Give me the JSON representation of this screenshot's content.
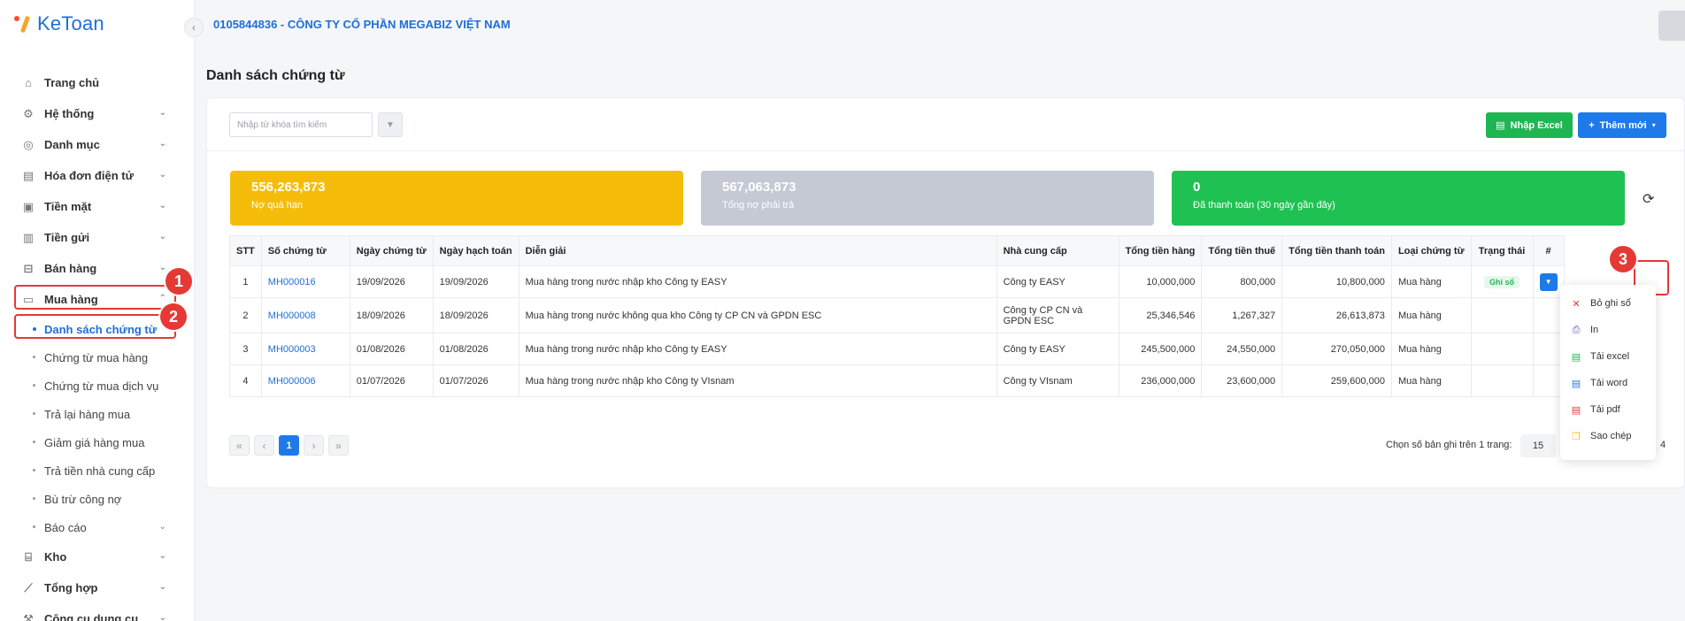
{
  "app": {
    "logo_text": "KeToan"
  },
  "header": {
    "company": "0105844836 - CÔNG TY CỔ PHẦN MEGABIZ VIỆT NAM"
  },
  "sidebar": {
    "items": [
      {
        "label": "Trang chủ",
        "icon": "home-icon"
      },
      {
        "label": "Hệ thống",
        "icon": "gear-icon"
      },
      {
        "label": "Danh mục",
        "icon": "grid-icon"
      },
      {
        "label": "Hóa đơn điện tử",
        "icon": "invoice-icon"
      },
      {
        "label": "Tiền mặt",
        "icon": "cash-icon"
      },
      {
        "label": "Tiền gửi",
        "icon": "bank-icon"
      },
      {
        "label": "Bán hàng",
        "icon": "sale-icon"
      },
      {
        "label": "Mua hàng",
        "icon": "folder-icon"
      }
    ],
    "sub_items": [
      "Danh sách chứng từ",
      "Chứng từ mua hàng",
      "Chứng từ mua dịch vụ",
      "Trả lại hàng mua",
      "Giảm giá hàng mua",
      "Trả tiền nhà cung cấp",
      "Bù trừ công nợ",
      "Báo cáo"
    ],
    "bottom_items": [
      {
        "label": "Kho",
        "icon": "warehouse-icon"
      },
      {
        "label": "Tổng hợp",
        "icon": "chart-icon"
      },
      {
        "label": "Công cụ dụng cụ",
        "icon": "tools-icon"
      }
    ]
  },
  "annotations": [
    "1",
    "2",
    "3"
  ],
  "page": {
    "title": "Danh sách chứng từ"
  },
  "toolbar": {
    "search_placeholder": "Nhập từ khóa tìm kiếm",
    "excel_label": "Nhập Excel",
    "new_label": "Thêm mới"
  },
  "stats": [
    {
      "value": "556,263,873",
      "label": "Nợ quá hạn"
    },
    {
      "value": "567,063,873",
      "label": "Tổng nợ phải trả"
    },
    {
      "value": "0",
      "label": "Đã thanh toán (30 ngày gần đây)"
    }
  ],
  "table": {
    "headers": [
      "STT",
      "Số chứng từ",
      "Ngày chứng từ",
      "Ngày hạch toán",
      "Diễn giải",
      "Nhà cung cấp",
      "Tổng tiền hàng",
      "Tổng tiền thuế",
      "Tổng tiền thanh toán",
      "Loại chứng từ",
      "Trạng thái",
      "#"
    ],
    "rows": [
      [
        "1",
        "MH000016",
        "19/09/2026",
        "19/09/2026",
        "Mua hàng trong nước nhập kho Công ty EASY",
        "Công ty EASY",
        "10,000,000",
        "800,000",
        "10,800,000",
        "Mua hàng",
        "Ghi sổ"
      ],
      [
        "2",
        "MH000008",
        "18/09/2026",
        "18/09/2026",
        "Mua hàng trong nước không qua kho Công ty CP CN và GPDN ESC",
        "Công ty CP CN và GPDN ESC",
        "25,346,546",
        "1,267,327",
        "26,613,873",
        "Mua hàng",
        ""
      ],
      [
        "3",
        "MH000003",
        "01/08/2026",
        "01/08/2026",
        "Mua hàng trong nước nhập kho Công ty EASY",
        "Công ty EASY",
        "245,500,000",
        "24,550,000",
        "270,050,000",
        "Mua hàng",
        ""
      ],
      [
        "4",
        "MH000006",
        "01/07/2026",
        "01/07/2026",
        "Mua hàng trong nước nhập kho Công ty VIsnam",
        "Công ty VIsnam",
        "236,000,000",
        "23,600,000",
        "259,600,000",
        "Mua hàng",
        ""
      ]
    ]
  },
  "pagination": {
    "current": "1",
    "per_page_label": "Chọn số bản ghi trên 1 trang:",
    "per_page": "15",
    "total": "4"
  },
  "dropdown": [
    {
      "label": "Bỏ ghi sổ",
      "icon": "x-icon",
      "color": "#e53935"
    },
    {
      "label": "In",
      "icon": "printer-icon",
      "color": "#5b3fd1"
    },
    {
      "label": "Tải excel",
      "icon": "excel-icon",
      "color": "#1fb553"
    },
    {
      "label": "Tải word",
      "icon": "word-icon",
      "color": "#1e7ae8"
    },
    {
      "label": "Tải pdf",
      "icon": "pdf-icon",
      "color": "#e53935"
    },
    {
      "label": "Sao chép",
      "icon": "copy-icon",
      "color": "#f5bd0a"
    }
  ]
}
